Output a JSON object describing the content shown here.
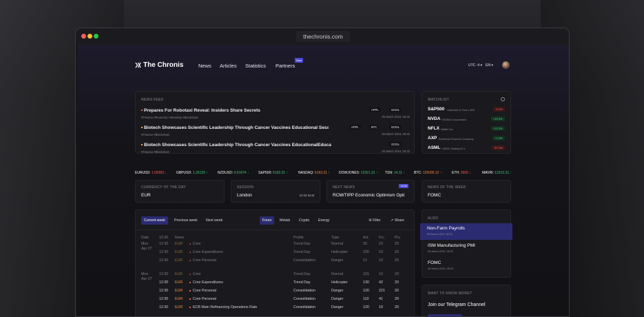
{
  "browser": {
    "url": "thechronis.com"
  },
  "nav": {
    "logo": "The Chronis",
    "links": [
      "News",
      "Articles",
      "Statistics",
      "Partners"
    ],
    "new_badge": "New",
    "utc": "UTC -4 ▾",
    "lang": "EN ▾"
  },
  "news_feed": {
    "label": "News Feed",
    "items": [
      {
        "title": "Prepares For Robotaxi Reveal: Insiders Share Secrets",
        "tags": "#Finance  #Economy / Monetary  #Blockchain",
        "symbols": [
          "APPL",
          "GOOL"
        ],
        "date": "06 March 2024, 08:32"
      },
      {
        "title": "Biotech Showcases Scientific Leadership Through Cancer Vaccines Educational Session",
        "tags": "#Finance  #Blockchain",
        "symbols": [
          "APPL",
          "BTC",
          "GOOL"
        ],
        "date": "06 March 2024, 08:32"
      },
      {
        "title": "Biotech Showcases Scientific Leadership Through Cancer Vaccines EducationalEducation",
        "tags": "#Finance  #Blockchain",
        "symbols": [
          "GOOL"
        ],
        "date": "06 March 2024, 08:32"
      }
    ]
  },
  "watchlist": {
    "label": "Watchlist",
    "items": [
      {
        "ticker": "S&P500",
        "name": "Standard & Poor's 500",
        "change": "-5.1%",
        "dir": "down"
      },
      {
        "ticker": "NVDA",
        "name": "NVIDIA Corporation",
        "change": "+10.3%",
        "dir": "up"
      },
      {
        "ticker": "NFLX",
        "name": "Netflix Inc.",
        "change": "+10.3%",
        "dir": "up"
      },
      {
        "ticker": "AXP",
        "name": "American Express Company",
        "change": "+1.3%",
        "dir": "up"
      },
      {
        "ticker": "ASML",
        "name": "ASML Holding N.V.",
        "change": "-37.1%",
        "dir": "down"
      }
    ]
  },
  "ticker": [
    {
      "sym": "EURUSD:",
      "val": "1.09383",
      "arrow": "↓",
      "dir": "down"
    },
    {
      "sym": "GBPUSD:",
      "val": "1.26120",
      "arrow": "↑",
      "dir": "up"
    },
    {
      "sym": "NZDUSD:",
      "val": "0.61674",
      "arrow": "↑",
      "dir": "up"
    },
    {
      "sym": "S&P500:",
      "val": "5163.31",
      "arrow": "↑",
      "dir": "up"
    },
    {
      "sym": "NASDAQ:",
      "val": "5163.31",
      "arrow": "↑",
      "dir": "up"
    },
    {
      "sym": "DOWJONES:",
      "val": "12321.31",
      "arrow": "↑",
      "dir": "up"
    },
    {
      "sym": "TSN:",
      "val": "14.11",
      "arrow": "↑",
      "dir": "up"
    },
    {
      "sym": "BTC:",
      "val": "125000.12",
      "arrow": "↑",
      "dir": "up"
    },
    {
      "sym": "ETH:",
      "val": "3900",
      "arrow": "↓",
      "dir": "down"
    },
    {
      "sym": "MAVRI:",
      "val": "12312.31",
      "arrow": "↑",
      "dir": "up"
    }
  ],
  "summary": {
    "currency_label": "Currency of the day",
    "currency": "EUR",
    "session_label": "Session",
    "session": "London",
    "session_time": "11:53 local",
    "next_label": "Next news",
    "next_badge": "18:26",
    "next_title": "RCM/TIPP Economic Optimism Opti",
    "week_label": "News of the week",
    "week_value": "FOMC"
  },
  "calendar": {
    "tabs": [
      "Current week",
      "Previous week",
      "Next week"
    ],
    "cats": [
      "Forex",
      "Metals",
      "Crypto",
      "Energy"
    ],
    "filter": "Filter",
    "share": "Share",
    "headers": [
      "Date",
      "12:30",
      "News",
      "Profile",
      "Type",
      "Act.",
      "Frc.",
      "Prv."
    ],
    "rows": [
      {
        "date": "Mon",
        "date2": "Apr 27",
        "time": "12:30",
        "cur": "EUR",
        "news": "Core",
        "profile": "Trend Day",
        "type": "Normal",
        "act": "30",
        "frc": "10",
        "prv": "20",
        "dim": true
      },
      {
        "date": "",
        "date2": "",
        "time": "12:30",
        "cur": "EUR",
        "news": "Core Expenditures",
        "profile": "Trend Day",
        "type": "Helicopter",
        "act": "200",
        "frc": "10",
        "prv": "20",
        "dim": true
      },
      {
        "date": "",
        "date2": "",
        "time": "12:30",
        "cur": "EUR",
        "news": "Core Personal",
        "profile": "Consolidation",
        "type": "Danger",
        "act": "12",
        "frc": "10",
        "prv": "20",
        "dim": true
      },
      {
        "date": "Mon",
        "date2": "Apr 27",
        "time": "12:30",
        "cur": "EUR",
        "news": "Core",
        "profile": "Trend Day",
        "type": "Normal",
        "act": "101",
        "frc": "10",
        "prv": "20",
        "dim": true
      },
      {
        "date": "",
        "date2": "",
        "time": "12:30",
        "cur": "EUR",
        "news": "Core Expenditures",
        "profile": "Trend Day",
        "type": "Helicopter",
        "act": "130",
        "frc": "42",
        "prv": "20",
        "dim": false
      },
      {
        "date": "",
        "date2": "",
        "time": "12:30",
        "cur": "EUR",
        "news": "Core Personal",
        "profile": "Consolidation",
        "type": "Danger",
        "act": "120",
        "frc": "221",
        "prv": "20",
        "dim": false
      },
      {
        "date": "",
        "date2": "",
        "time": "12:30",
        "cur": "EUR",
        "news": "Core Personal",
        "profile": "Consolidation",
        "type": "Danger",
        "act": "110",
        "frc": "41",
        "prv": "20",
        "dim": false
      },
      {
        "date": "",
        "date2": "",
        "time": "12:30",
        "cur": "EUR",
        "news": "ECB Main Refinancing Operations Rate",
        "profile": "Consolidation",
        "type": "Danger",
        "act": "120",
        "frc": "10",
        "prv": "20",
        "dim": false
      }
    ]
  },
  "algo": {
    "label": "Algo",
    "items": [
      {
        "title": "Non-Farm Payrolls",
        "date": "06 March 2024, 08:32"
      },
      {
        "title": "ISM Manufacturing PMI",
        "date": "06 March 2024, 08:32"
      },
      {
        "title": "FOMC",
        "date": "06 March 2024, 08:32"
      }
    ]
  },
  "telegram": {
    "label": "Want to know more?",
    "title": "Join our Telegram Channel"
  },
  "colors": {
    "accent": "#4a4ad6",
    "up": "#3ed07a",
    "down": "#ff5a4f",
    "warn": "#ff8a3a"
  }
}
